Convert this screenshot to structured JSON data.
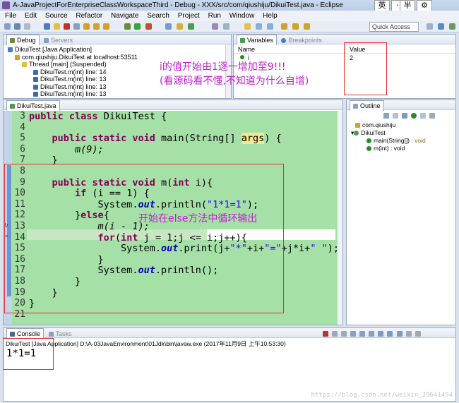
{
  "window": {
    "title": "A-JavaProjectForEnterpriseClassWorkspaceThird - Debug - XXX/src/com/qiushiju/DikuiTest.java - Eclipse",
    "ime_buttons": [
      "英",
      "·,",
      "半",
      "⚙"
    ]
  },
  "menu": [
    "File",
    "Edit",
    "Source",
    "Refactor",
    "Navigate",
    "Search",
    "Project",
    "Run",
    "Window",
    "Help"
  ],
  "quick_access": "Quick Access",
  "debug_panel": {
    "tabs": [
      "Debug",
      "Servers"
    ],
    "tree": [
      "DikuiTest [Java Application]",
      "com.qiushiju.DikuiTest at localhost:53511",
      "Thread [main] (Suspended)",
      "DikuiTest.m(int) line: 14",
      "DikuiTest.m(int) line: 13",
      "DikuiTest.m(int) line: 13",
      "DikuiTest.m(int) line: 13"
    ]
  },
  "variables_panel": {
    "tabs": [
      "Variables",
      "Breakpoints"
    ],
    "columns": [
      "Name",
      "Value"
    ],
    "rows": [
      {
        "name": "i",
        "value": "2"
      }
    ]
  },
  "annotations": {
    "top_line1": "i的值开始由1逐一增加至9!!!",
    "top_line2": "(看源码看不懂,不知道为什么自增)",
    "code_note": "开始在else方法中循环输出"
  },
  "editor": {
    "tab": "DikuiTest.java",
    "line_numbers": [
      "3",
      "4",
      "5",
      "6",
      "7",
      "8",
      "9",
      "10",
      "11",
      "12",
      "13",
      "14",
      "15",
      "16",
      "17",
      "18",
      "19",
      "20",
      "21"
    ],
    "tokens": {
      "kw_public": "public",
      "kw_class": "class",
      "kw_static": "static",
      "kw_void": "void",
      "kw_int": "int",
      "kw_if": "if",
      "kw_else": "else",
      "kw_for": "for",
      "cls_name": " DikuiTest {",
      "main_sig_a": " main(String[] ",
      "main_args": "args",
      "main_sig_b": ") {",
      "call_m9": "m(9);",
      "brace_close": "}",
      "m_sig_a": " m(",
      "m_sig_b": " i){",
      "if_cond": " (i == 1) {",
      "system": "System.",
      "out": "out",
      "println_open": ".println(",
      "str_1x1": "\"1*1=1\"",
      "close_semi": ");",
      "else_a": "}",
      "else_b": "{",
      "m_recurse": "m(i - 1);",
      "for_a": "(",
      "for_b": " j = 1;j <= i;j++){",
      "print_open": ".print(j+",
      "str_star": "\"*\"",
      "plus_i_plus": "+i+",
      "str_eq": "\"=\"",
      "plus_ji_plus": "+j*i+",
      "str_sp": "\" \"",
      "println_empty": ".println();"
    }
  },
  "outline_panel": {
    "tab": "Outline",
    "items": [
      "com.qiushiju",
      "DikuiTest",
      "main(String[])",
      " : void",
      "m(int) : void"
    ]
  },
  "console_panel": {
    "tabs": [
      "Console",
      "Tasks"
    ],
    "launch": "DikuiTest [Java Application] D:\\A-03JavaEnvironment\\01Jdk\\bin\\javaw.exe (2017年11月9日 上午10:53:30)",
    "output": "1*1=1"
  },
  "watermark": "https://blog.csdn.net/weixin_39641494",
  "colors": {
    "annotation": "#c21fcf",
    "highlight_box": "#e53030",
    "code_bg": "#a5e0a7",
    "keyword": "#7f0055",
    "string": "#2a00ff",
    "field": "#0000c0"
  }
}
